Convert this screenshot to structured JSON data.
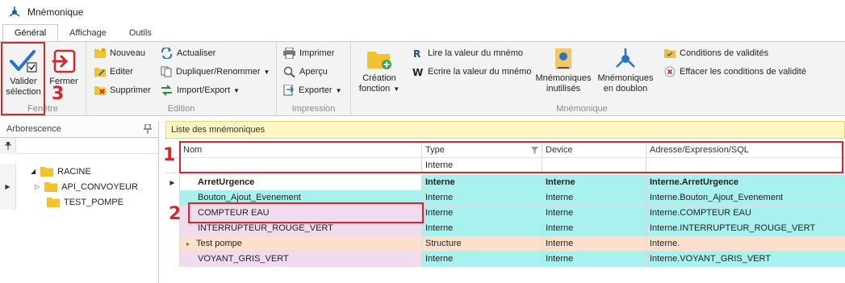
{
  "window": {
    "title": "Mnémonique"
  },
  "tabs": [
    {
      "label": "Général",
      "active": true
    },
    {
      "label": "Affichage",
      "active": false
    },
    {
      "label": "Outils",
      "active": false
    }
  ],
  "ribbon": {
    "fenetre": {
      "label": "Fenêtre",
      "valider": "Valider\nsélection",
      "valider_l1": "Valider",
      "valider_l2": "sélection",
      "fermer": "Fermer"
    },
    "edition": {
      "label": "Edition",
      "nouveau": "Nouveau",
      "editer": "Editer",
      "supprimer": "Supprimer",
      "actualiser": "Actualiser",
      "dupliquer": "Dupliquer/Renommer",
      "import_export": "Import/Export"
    },
    "impression": {
      "label": "Impression",
      "imprimer": "Imprimer",
      "apercu": "Aperçu",
      "exporter": "Exporter"
    },
    "mnemonique": {
      "label": "Mnémonique",
      "creation_l1": "Création",
      "creation_l2": "fonction",
      "lire": "Lire la valeur du mnémo",
      "ecrire": "Ecrire la valeur du mnémo",
      "inutilises_l1": "Mnémoniques",
      "inutilises_l2": "inutilisés",
      "doublon_l1": "Mnémoniques",
      "doublon_l2": "en doublon",
      "conditions": "Conditions de validités",
      "effacer": "Effacer les conditions de validité"
    }
  },
  "annotations": {
    "n1": "1",
    "n2": "2",
    "n3": "3"
  },
  "tree": {
    "header": "Arborescence",
    "items": [
      {
        "label": "RACINE"
      },
      {
        "label": "API_CONVOYEUR"
      },
      {
        "label": "TEST_POMPE"
      }
    ]
  },
  "grid": {
    "title": "Liste des mnémoniques",
    "columns": [
      "Nom",
      "Type",
      "Device",
      "Adresse/Expression/SQL"
    ],
    "filter": {
      "nom": "",
      "type": "Interne",
      "device": "",
      "adresse": ""
    },
    "rows": [
      {
        "nom": "ArretUrgence",
        "type": "Interne",
        "device": "Interne",
        "adresse": "Interne.ArretUrgence"
      },
      {
        "nom": "Bouton_Ajout_Evenement",
        "type": "Interne",
        "device": "Interne",
        "adresse": "Interne.Bouton_Ajout_Evenement"
      },
      {
        "nom": "COMPTEUR EAU",
        "type": "Interne",
        "device": "Interne",
        "adresse": "Interne.COMPTEUR EAU"
      },
      {
        "nom": "INTERRUPTEUR_ROUGE_VERT",
        "type": "Interne",
        "device": "Interne",
        "adresse": "Interne.INTERRUPTEUR_ROUGE_VERT"
      },
      {
        "nom": "Test pompe",
        "type": "Structure",
        "device": "Interne",
        "adresse": "Interne."
      },
      {
        "nom": "VOYANT_GRIS_VERT",
        "type": "Interne",
        "device": "Interne",
        "adresse": "Interne.VOYANT_GRIS_VERT"
      }
    ]
  },
  "colors": {
    "accent": "#d9262c",
    "cyan_row": "#a9f1ef",
    "pink_row": "#f1dcef",
    "orange_row": "#fde0cc",
    "folder": "#f2c230"
  }
}
